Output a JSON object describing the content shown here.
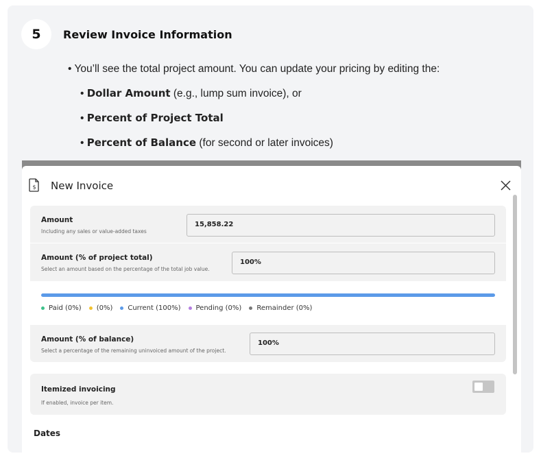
{
  "step": {
    "number": "5",
    "title": "Review Invoice Information"
  },
  "bullets": {
    "intro": "You’ll see the total project amount. You can update your pricing by editing the:",
    "dollar_bold": "Dollar Amount",
    "dollar_rest": " (e.g., lump sum invoice), or",
    "percent_total_bold": "Percent of Project Total",
    "percent_balance_bold": "Percent of Balance",
    "percent_balance_rest": " (for second or later invoices)"
  },
  "modal": {
    "title": "New Invoice",
    "amount": {
      "label": "Amount",
      "hint": "Including any sales or value-added taxes",
      "value": "15,858.22"
    },
    "amount_project": {
      "label": "Amount (% of project total)",
      "hint": "Select an amount based on the percentage of the total job value.",
      "value": "100%"
    },
    "progress": {
      "current_fraction": 1.0
    },
    "legend": [
      {
        "label": "Paid (0%)",
        "color": "#3ec18b"
      },
      {
        "label": "(0%)",
        "color": "#f2c230"
      },
      {
        "label": "Current (100%)",
        "color": "#5b9ae8"
      },
      {
        "label": "Pending (0%)",
        "color": "#b47fe0"
      },
      {
        "label": "Remainder (0%)",
        "color": "#777777"
      }
    ],
    "amount_balance": {
      "label": "Amount (% of balance)",
      "hint": "Select a percentage of the remaining uninvoiced amount of the project.",
      "value": "100%"
    },
    "itemized": {
      "label": "Itemized invoicing",
      "hint": "If enabled, invoice per item.",
      "enabled": false
    },
    "dates_heading": "Dates",
    "icons": {
      "document": "invoice-document-icon",
      "close": "close-icon"
    }
  }
}
